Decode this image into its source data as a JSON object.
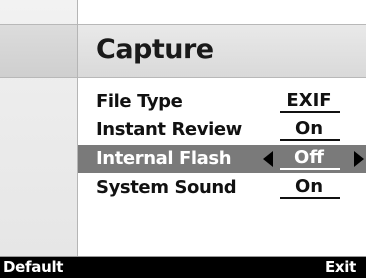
{
  "menu": {
    "title": "Capture",
    "items": [
      {
        "label": "File Type",
        "value": "EXIF"
      },
      {
        "label": "Instant Review",
        "value": "On"
      },
      {
        "label": "Internal Flash",
        "value": "Off"
      },
      {
        "label": "System Sound",
        "value": "On"
      }
    ],
    "selected_item": "Internal Flash"
  },
  "softkeys": {
    "left": "Default",
    "right": "Exit"
  },
  "icons": {
    "prev_value": "left-arrow-icon",
    "next_value": "right-arrow-icon"
  },
  "colors": {
    "selected_row_bg": "#7a7a7a",
    "footer_bg": "#000000",
    "text": "#111111"
  }
}
